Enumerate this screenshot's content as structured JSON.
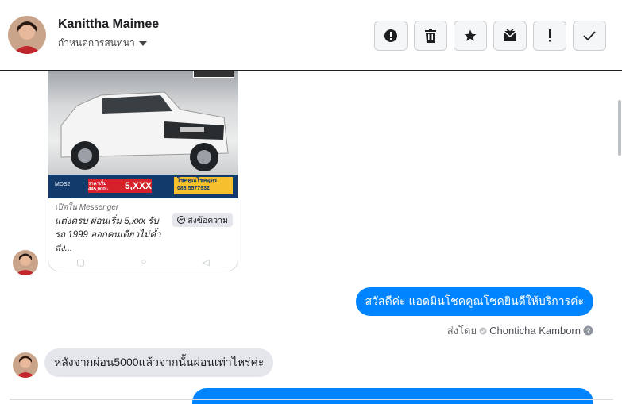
{
  "header": {
    "contact_name": "Kanittha Maimee",
    "subtitle": "กำหนดการสนทนา",
    "actions": [
      {
        "icon": "alert-circle-icon"
      },
      {
        "icon": "trash-icon"
      },
      {
        "icon": "star-icon"
      },
      {
        "icon": "mark-unread-icon"
      },
      {
        "icon": "exclamation-icon"
      },
      {
        "icon": "check-icon"
      }
    ]
  },
  "ad_card": {
    "price_label": "ผ่อนเริ่ม",
    "price": "5,XXX",
    "price_small": "ราคาเริ่ม 445,000.-",
    "model": "MDS2",
    "promo_line1": "โชคคูณโชคอุดร",
    "promo_line2": "088 5577932",
    "caption_sub": "เปิดใน Messenger",
    "caption_text": "แต่งครบ ผ่อนเริ่ม 5,xxx รับรถ 1999 ออกคนเดียวไม่ค้ำ ส่ง...",
    "button_label": "ส่งข้อความ"
  },
  "messages": {
    "outgoing_1": "สวัสดีค่ะ แอดมินโชคคูณโชคยินดีให้บริการค่ะ",
    "sent_by_label": "ส่งโดย",
    "sent_by_agent": "Chonticha Kamborn",
    "incoming_1": "หลังจากผ่อน5000แล้วจากนั้นผ่อนเท่าไหร่ค่ะ"
  },
  "colors": {
    "messenger_blue": "#0084ff",
    "incoming_gray": "#e4e6eb",
    "price_red": "#d6212a",
    "banner_navy": "#123b6c",
    "promo_yellow": "#f5c02b"
  }
}
